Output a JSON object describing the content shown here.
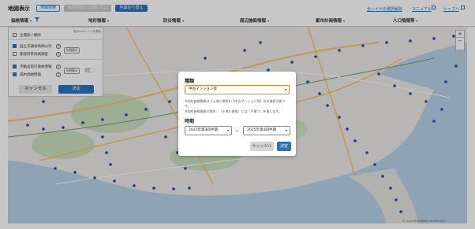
{
  "header": {
    "title": "地図表示",
    "buttons": [
      "地域検索",
      "価格情報の詳細を表示",
      "地図切り替え"
    ],
    "links": [
      "全レイヤの選択解除",
      "マニュアル",
      "トップへ"
    ]
  },
  "filters": [
    {
      "label": "価格情報",
      "icon": "funnel-icon"
    },
    {
      "label": "地形情報"
    },
    {
      "label": "防災情報"
    },
    {
      "label": "周辺施設情報"
    },
    {
      "label": "都市計画情報"
    },
    {
      "label": "人口情報等"
    }
  ],
  "layer_panel": {
    "header_right": "表示中のレイヤを選択",
    "items": [
      {
        "label": "全選択 / 解除",
        "checked": false
      },
      {
        "label": "国土交通省地価公示",
        "checked": true,
        "button": "凡例表示"
      },
      {
        "label": "都道府県地価調査",
        "checked": false
      },
      {
        "label": "不動産取引価格情報",
        "checked": true,
        "button": "凡例表示"
      },
      {
        "label": "成約価格情報",
        "checked": true
      }
    ],
    "cancel_label": "キャンセル",
    "ok_label": "決定"
  },
  "modal": {
    "type_title": "種類",
    "type_value": "中古マンション等",
    "notes": [
      "※成約価格情報は【土地と建物】・【中古マンション等】のみ検索可能です。",
      "※成約価格情報の場合、「土地と建物」とは「戸建て」を指します。"
    ],
    "period_title": "時期",
    "period_from": "2023年第3四半期",
    "period_sep": "〜",
    "period_to": "2025年第4四半期",
    "cancel_label": "キャンセル",
    "ok_label": "決定"
  },
  "map": {
    "zoom_in": "+",
    "zoom_out": "−",
    "attribution": "© OpenStreetMap contributors",
    "colors": {
      "land": "#ebeae7",
      "water": "#b7d2e8",
      "road": "#f2c46a",
      "green": "#c9dfbf",
      "station": "#1f4fa8"
    }
  }
}
